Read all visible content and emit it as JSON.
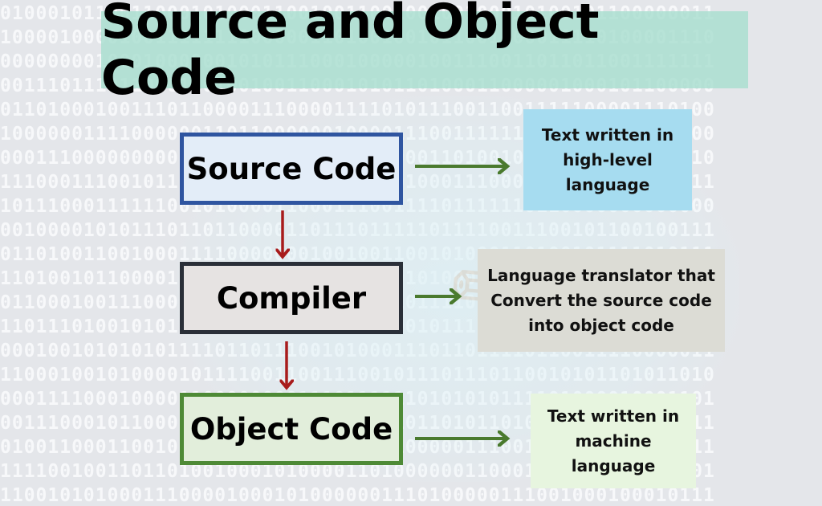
{
  "title": "Source and Object Code",
  "background_pattern": "binary digits 0/1",
  "colors": {
    "title_band": "#a8ded0",
    "source_border": "#2f55a0",
    "compiler_border": "#2a2f38",
    "object_border": "#4e8a36",
    "flow_arrow": "#a81c1c",
    "side_arrow": "#4a7a2e",
    "desc_source_bg": "#a6dcf0",
    "desc_compiler_bg": "#dcdcd5",
    "desc_object_bg": "#e7f5df"
  },
  "nodes": [
    {
      "id": "source",
      "label": "Source Code"
    },
    {
      "id": "compiler",
      "label": "Compiler"
    },
    {
      "id": "object",
      "label": "Object Code"
    }
  ],
  "descriptions": [
    {
      "for": "source",
      "lines": [
        "Text written in",
        "high-level",
        "language"
      ]
    },
    {
      "for": "compiler",
      "lines": [
        "Language translator that",
        "Convert the source code",
        "into object code"
      ]
    },
    {
      "for": "object",
      "lines": [
        "Text written in",
        "machine",
        "language"
      ]
    }
  ],
  "edges": [
    {
      "from": "source",
      "to": "compiler",
      "type": "flow-arrow"
    },
    {
      "from": "compiler",
      "to": "object",
      "type": "flow-arrow"
    },
    {
      "from": "source",
      "to": "source-description",
      "type": "side-arrow"
    },
    {
      "from": "compiler",
      "to": "compiler-description",
      "type": "side-arrow"
    },
    {
      "from": "object",
      "to": "object-description",
      "type": "side-arrow"
    }
  ]
}
